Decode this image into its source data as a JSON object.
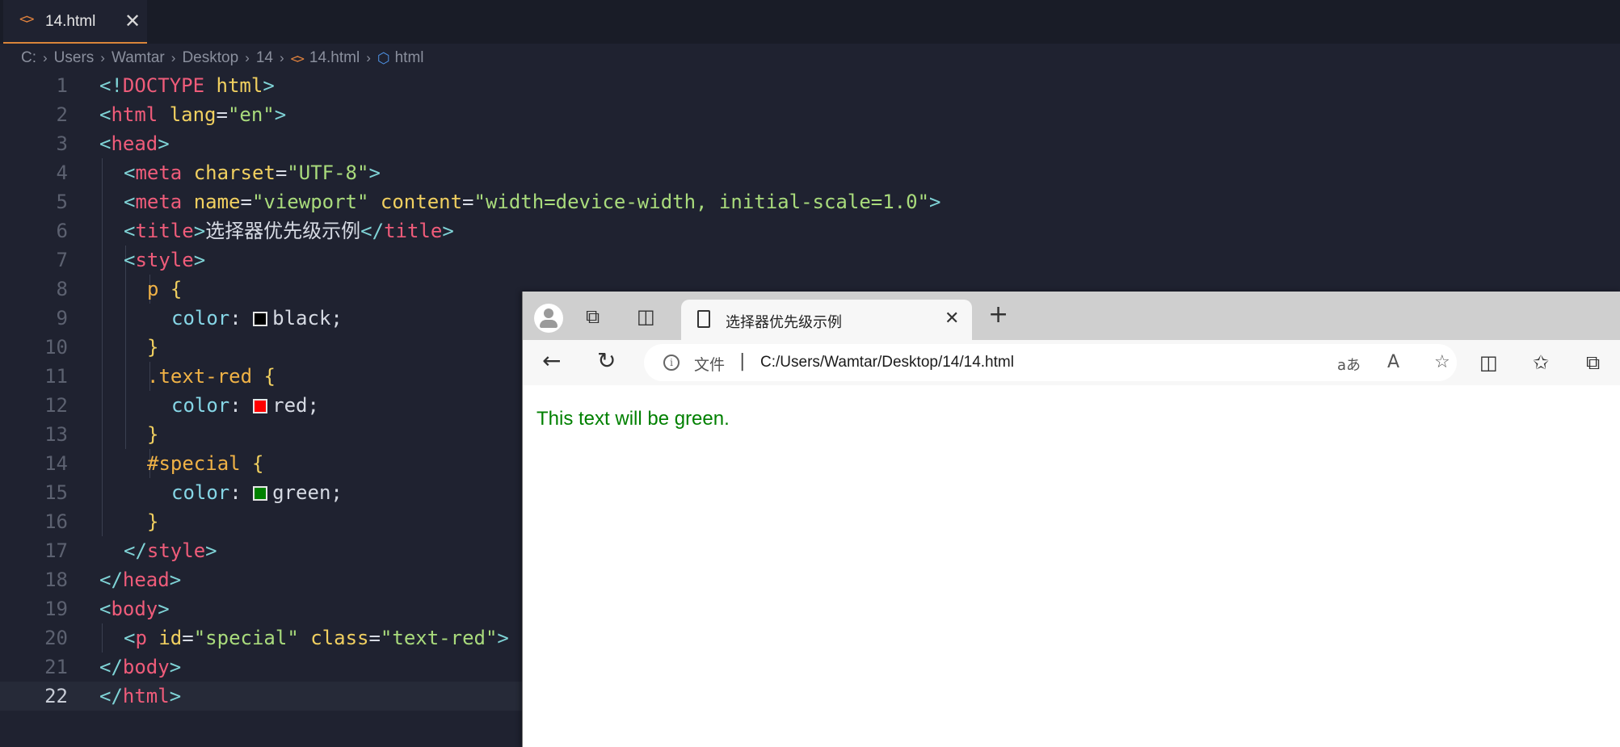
{
  "editor": {
    "tab": {
      "icon": "<>",
      "label": "14.html",
      "close": "✕"
    },
    "breadcrumb": [
      "C:",
      "Users",
      "Wamtar",
      "Desktop",
      "14",
      "14.html",
      "html"
    ],
    "line_numbers": [
      "1",
      "2",
      "3",
      "4",
      "5",
      "6",
      "7",
      "8",
      "9",
      "10",
      "11",
      "12",
      "13",
      "14",
      "15",
      "16",
      "17",
      "18",
      "19",
      "20",
      "21",
      "22"
    ],
    "code": {
      "l1": {
        "a": "<!",
        "b": "DOCTYPE",
        "c": " html",
        "d": ">"
      },
      "l2": {
        "a": "<",
        "b": "html",
        "c": " lang",
        "d": "=",
        "e": "\"en\"",
        "f": ">"
      },
      "l3": {
        "a": "<",
        "b": "head",
        "c": ">"
      },
      "l4": {
        "a": "<",
        "b": "meta",
        "c": " charset",
        "d": "=",
        "e": "\"UTF-8\"",
        "f": ">"
      },
      "l5": {
        "a": "<",
        "b": "meta",
        "c": " name",
        "d": "=",
        "e": "\"viewport\"",
        "g": " content",
        "h": "=",
        "i": "\"width=device-width, initial-scale=1.0\"",
        "f": ">"
      },
      "l6": {
        "a": "<",
        "b": "title",
        "c": ">",
        "d": "选择器优先级示例",
        "e": "</",
        "f": "title",
        "g": ">"
      },
      "l7": {
        "a": "<",
        "b": "style",
        "c": ">"
      },
      "l8": {
        "a": "p",
        "b": " {"
      },
      "l9": {
        "a": "color",
        "b": ": ",
        "c": "black;"
      },
      "l10": {
        "a": "}"
      },
      "l11": {
        "a": ".text-red",
        "b": " {"
      },
      "l12": {
        "a": "color",
        "b": ": ",
        "c": "red;"
      },
      "l13": {
        "a": "}"
      },
      "l14": {
        "a": "#special",
        "b": " {"
      },
      "l15": {
        "a": "color",
        "b": ": ",
        "c": "green;"
      },
      "l16": {
        "a": "}"
      },
      "l17": {
        "a": "</",
        "b": "style",
        "c": ">"
      },
      "l18": {
        "a": "</",
        "b": "head",
        "c": ">"
      },
      "l19": {
        "a": "<",
        "b": "body",
        "c": ">"
      },
      "l20": {
        "a": "<",
        "b": "p",
        "c": " id",
        "d": "=",
        "e": "\"special\"",
        "g": " class",
        "h": "=",
        "i": "\"text-red\"",
        "f": ">"
      },
      "l21": {
        "a": "</",
        "b": "body",
        "c": ">"
      },
      "l22": {
        "a": "</",
        "b": "html",
        "c": ">"
      }
    },
    "swatches": {
      "black": "#000000",
      "red": "#ff0000",
      "green": "#008000"
    },
    "icons": {
      "tab_file": "html-file-icon",
      "crumb_element": "cube-icon"
    }
  },
  "browser": {
    "tab_title": "选择器优先级示例",
    "tab_close": "✕",
    "new_tab": "+",
    "address": {
      "scheme_label": "文件",
      "separator": "|",
      "url": "C:/Users/Wamtar/Desktop/14/14.html"
    },
    "toolbar_icons": [
      "back-icon",
      "refresh-icon",
      "translate-icon",
      "read-aloud-icon",
      "favorite-icon",
      "split-screen-icon",
      "favorites-icon",
      "collections-icon"
    ],
    "read_aloud_glyph": "A",
    "translate_glyph": "aあ",
    "page_text": "This text will be green.",
    "page_text_color": "#008000"
  }
}
